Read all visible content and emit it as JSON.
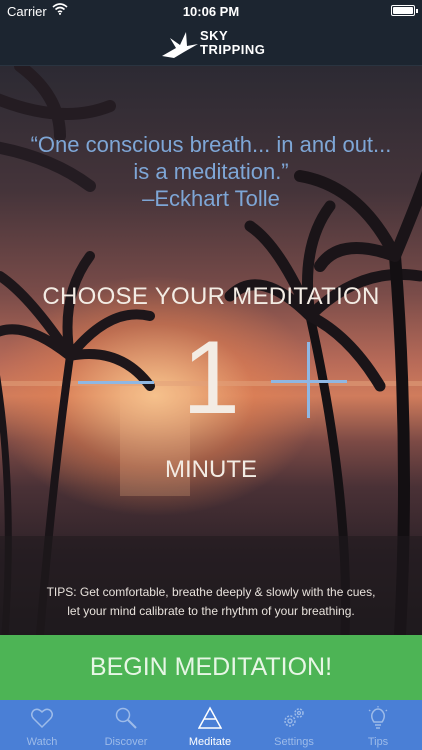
{
  "status_bar": {
    "carrier": "Carrier",
    "time": "10:06 PM",
    "battery_level": 1.0
  },
  "header": {
    "logo_line1": "SKY",
    "logo_line2": "TRIPPING",
    "logo_icon": "bird-icon"
  },
  "quote": {
    "line1": "“One conscious breath... in and out...",
    "line2": "is a meditation.”",
    "author": "–Eckhart Tolle",
    "color": "#7ea6d6"
  },
  "meditation": {
    "title": "CHOOSE YOUR MEDITATION",
    "value": "1",
    "unit": "MINUTE",
    "decrement_icon": "minus-icon",
    "increment_icon": "plus-icon"
  },
  "tips": {
    "line1": "TIPS: Get comfortable, breathe deeply & slowly with the cues,",
    "line2": "let your mind calibrate to the rhythm of your breathing."
  },
  "begin_button": {
    "label": "BEGIN MEDITATION!",
    "color": "#4db455"
  },
  "tab_bar": {
    "color": "#4a7fd6",
    "active": "Meditate",
    "tabs": [
      {
        "label": "Watch",
        "icon": "heart-icon"
      },
      {
        "label": "Discover",
        "icon": "magnifier-icon"
      },
      {
        "label": "Meditate",
        "icon": "triangle-icon"
      },
      {
        "label": "Settings",
        "icon": "gears-icon"
      },
      {
        "label": "Tips",
        "icon": "lightbulb-icon"
      }
    ]
  }
}
